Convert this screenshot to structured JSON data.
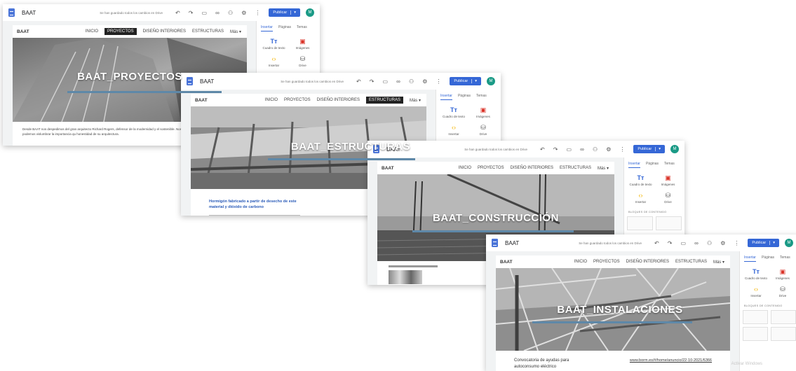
{
  "app": {
    "title": "BAAT",
    "saved_status": "Se han guardado todos los cambios en Drive",
    "publish_label": "Publicar",
    "avatar_initial": "M",
    "toolbar_icons": [
      "undo-icon",
      "redo-icon",
      "preview-icon",
      "link-icon",
      "share-icon",
      "settings-icon",
      "more-icon"
    ]
  },
  "site": {
    "name": "BAAT",
    "more_label": "Más"
  },
  "panel": {
    "tabs": [
      "Insertar",
      "Páginas",
      "Temas"
    ],
    "items": [
      "Cuadro de texto",
      "Imágenes",
      "Insertar",
      "Drive"
    ],
    "blocks_label": "BLOQUES DE CONTENIDO"
  },
  "windows": [
    {
      "nav": [
        "INICIO",
        "PROYECTOS",
        "DISEÑO INTERIORES",
        "ESTRUCTURAS"
      ],
      "active_nav": 1,
      "hero_title": "BAAT_PROYECTOS",
      "body_text": "Desde BAAT nos despedimos del gran arquitecto Richard Rogers, defensor de la modernidad y el sostenible. Nos deja un legado de obras construidas donde podemos vislumbrar la importancia qu honestidad de su arquitectura."
    },
    {
      "nav": [
        "INICIO",
        "PROYECTOS",
        "DISEÑO INTERIORES",
        "ESTRUCTURAS"
      ],
      "active_nav": 3,
      "hero_title": "BAAT_ESTRUCTURAS",
      "body_text": "Hormigón fabricado a partir de desecho de este material y dióxido de carbono"
    },
    {
      "nav": [
        "INICIO",
        "PROYECTOS",
        "DISEÑO INTERIORES",
        "ESTRUCTURAS"
      ],
      "active_nav": -1,
      "hero_title": "BAAT_CONSTRUCCIÓN",
      "body_text": ""
    },
    {
      "nav": [
        "INICIO",
        "PROYECTOS",
        "DISEÑO INTERIORES",
        "ESTRUCTURAS"
      ],
      "active_nav": -1,
      "hero_title": "BAAT_INSTALACIONES",
      "body_text": "Convocatoria de ayudas para autoconsumo eléctrico",
      "link_text": "www.borm.es/#/home/anuncio/22-10-2021/6366"
    }
  ],
  "watermark": "Activar Windows"
}
